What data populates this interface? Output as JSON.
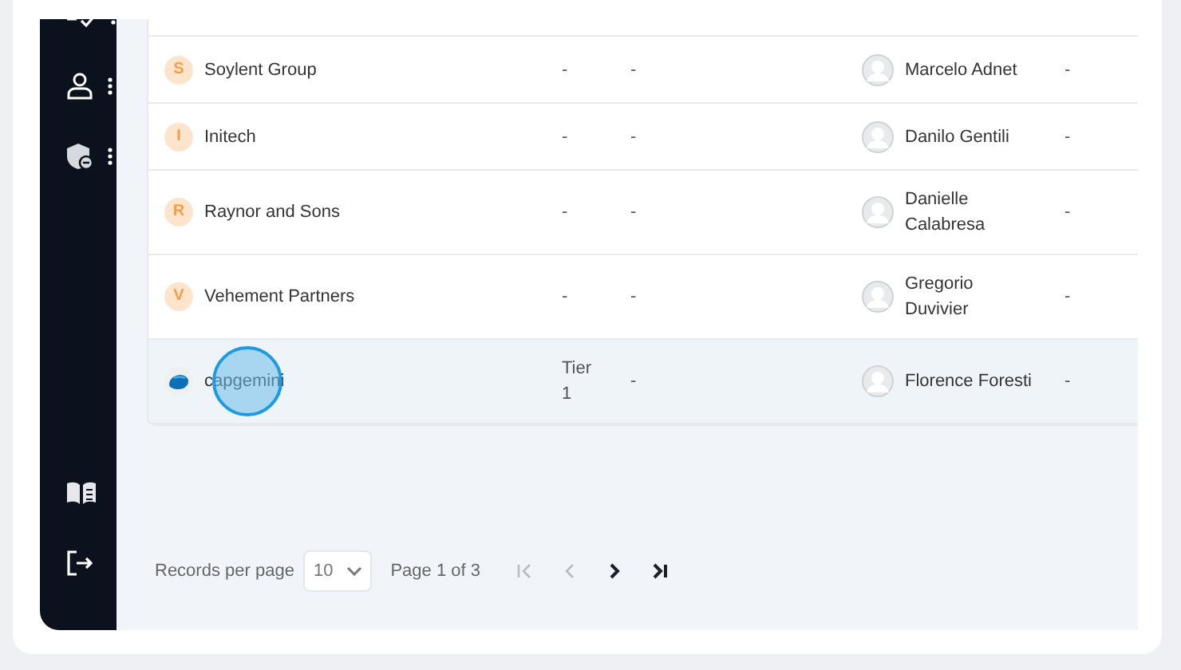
{
  "table": {
    "rows": [
      {
        "name": "Soylent Group",
        "initial": "S",
        "kind": "letter",
        "column_2": "-",
        "column_3": "-",
        "owner": "Marcelo Adnet",
        "column_5": "-",
        "selected": false,
        "click_highlight": false
      },
      {
        "name": "Initech",
        "initial": "I",
        "kind": "letter",
        "column_2": "-",
        "column_3": "-",
        "owner": "Danilo Gentili",
        "column_5": "-",
        "selected": false,
        "click_highlight": false
      },
      {
        "name": "Raynor and Sons",
        "initial": "R",
        "kind": "letter",
        "column_2": "-",
        "column_3": "-",
        "owner": "Danielle Calabresa",
        "column_5": "-",
        "selected": false,
        "click_highlight": false
      },
      {
        "name": "Vehement Partners",
        "initial": "V",
        "kind": "letter",
        "column_2": "-",
        "column_3": "-",
        "owner": "Gregorio Duvivier",
        "column_5": "-",
        "selected": false,
        "click_highlight": false
      },
      {
        "name": "capgemini",
        "kind": "logo",
        "column_2": "Tier 1",
        "column_3": "-",
        "owner": "Florence Foresti",
        "column_5": "-",
        "selected": true,
        "click_highlight": true
      }
    ]
  },
  "pagination": {
    "label": "Records per page",
    "page_size": "10",
    "page_info": "Page 1 of 3",
    "buttons": [
      {
        "kind": "first",
        "disabled": true
      },
      {
        "kind": "prev",
        "disabled": true
      },
      {
        "kind": "next",
        "disabled": false
      },
      {
        "kind": "last",
        "disabled": false
      }
    ]
  }
}
